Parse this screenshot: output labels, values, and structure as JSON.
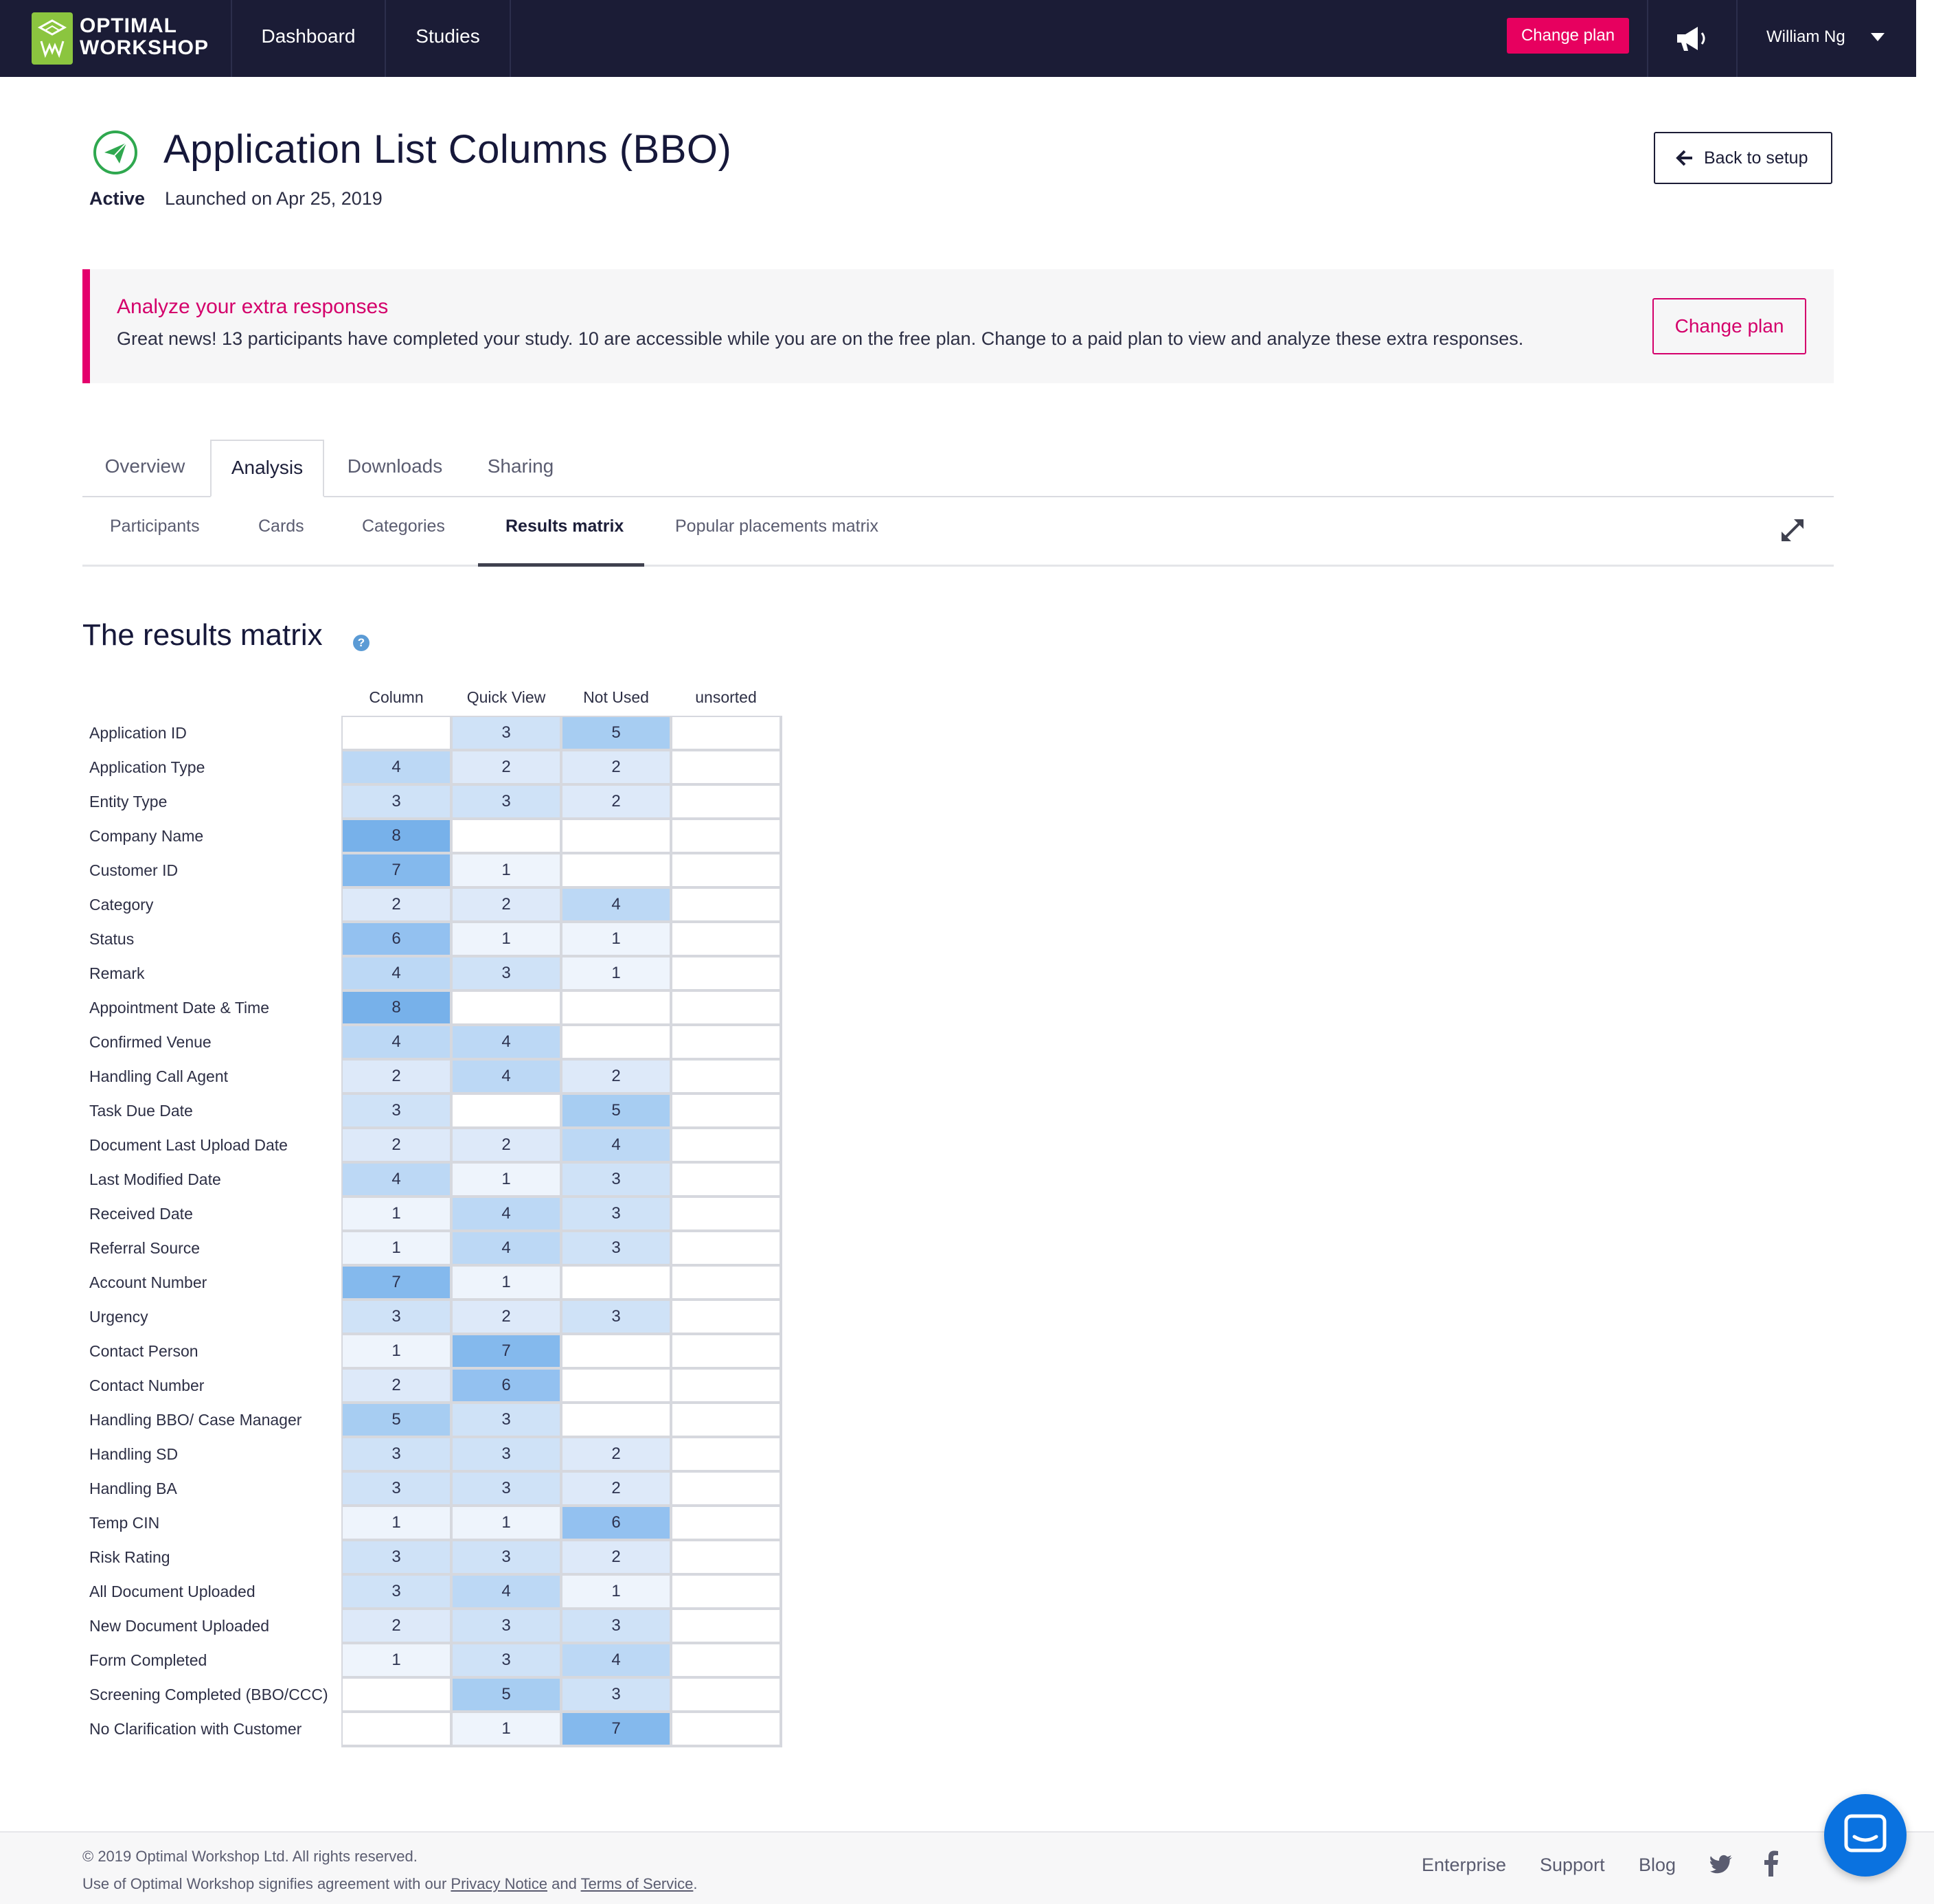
{
  "nav": {
    "logo_text": "OPTIMAL\nWORKSHOP",
    "links": [
      "Dashboard",
      "Studies"
    ],
    "change_plan": "Change plan",
    "user_name": "William Ng"
  },
  "study": {
    "title": "Application List Columns (BBO)",
    "status": "Active",
    "launched": "Launched on Apr 25, 2019",
    "back_label": "Back to setup"
  },
  "banner": {
    "title": "Analyze your extra responses",
    "text": "Great news! 13 participants have completed your study. 10 are accessible while you are on the free plan. Change to a paid plan to view and analyze these extra responses.",
    "button": "Change plan"
  },
  "tabs": [
    "Overview",
    "Analysis",
    "Downloads",
    "Sharing"
  ],
  "active_tab": "Analysis",
  "subtabs": [
    "Participants",
    "Cards",
    "Categories",
    "Results matrix",
    "Popular placements matrix"
  ],
  "active_subtab": "Results matrix",
  "matrix": {
    "title": "The results matrix",
    "help": "?",
    "columns": [
      "Column",
      "Quick View",
      "Not Used",
      "unsorted"
    ],
    "rows": [
      {
        "card": "Application ID",
        "values": [
          null,
          3,
          5,
          null
        ]
      },
      {
        "card": "Application Type",
        "values": [
          4,
          2,
          2,
          null
        ]
      },
      {
        "card": "Entity Type",
        "values": [
          3,
          3,
          2,
          null
        ]
      },
      {
        "card": "Company Name",
        "values": [
          8,
          null,
          null,
          null
        ]
      },
      {
        "card": "Customer ID",
        "values": [
          7,
          1,
          null,
          null
        ]
      },
      {
        "card": "Category",
        "values": [
          2,
          2,
          4,
          null
        ]
      },
      {
        "card": "Status",
        "values": [
          6,
          1,
          1,
          null
        ]
      },
      {
        "card": "Remark",
        "values": [
          4,
          3,
          1,
          null
        ]
      },
      {
        "card": "Appointment Date & Time",
        "values": [
          8,
          null,
          null,
          null
        ]
      },
      {
        "card": "Confirmed Venue",
        "values": [
          4,
          4,
          null,
          null
        ]
      },
      {
        "card": "Handling Call Agent",
        "values": [
          2,
          4,
          2,
          null
        ]
      },
      {
        "card": "Task Due Date",
        "values": [
          3,
          null,
          5,
          null
        ]
      },
      {
        "card": "Document Last Upload Date",
        "values": [
          2,
          2,
          4,
          null
        ]
      },
      {
        "card": "Last Modified Date",
        "values": [
          4,
          1,
          3,
          null
        ]
      },
      {
        "card": "Received Date",
        "values": [
          1,
          4,
          3,
          null
        ]
      },
      {
        "card": "Referral Source",
        "values": [
          1,
          4,
          3,
          null
        ]
      },
      {
        "card": "Account Number",
        "values": [
          7,
          1,
          null,
          null
        ]
      },
      {
        "card": "Urgency",
        "values": [
          3,
          2,
          3,
          null
        ]
      },
      {
        "card": "Contact Person",
        "values": [
          1,
          7,
          null,
          null
        ]
      },
      {
        "card": "Contact Number",
        "values": [
          2,
          6,
          null,
          null
        ]
      },
      {
        "card": "Handling BBO/ Case Manager",
        "values": [
          5,
          3,
          null,
          null
        ]
      },
      {
        "card": "Handling SD",
        "values": [
          3,
          3,
          2,
          null
        ]
      },
      {
        "card": "Handling BA",
        "values": [
          3,
          3,
          2,
          null
        ]
      },
      {
        "card": "Temp CIN",
        "values": [
          1,
          1,
          6,
          null
        ]
      },
      {
        "card": "Risk Rating",
        "values": [
          3,
          3,
          2,
          null
        ]
      },
      {
        "card": "All Document Uploaded",
        "values": [
          3,
          4,
          1,
          null
        ]
      },
      {
        "card": "New Document Uploaded",
        "values": [
          2,
          3,
          3,
          null
        ]
      },
      {
        "card": "Form Completed",
        "values": [
          1,
          3,
          4,
          null
        ]
      },
      {
        "card": "Screening Completed (BBO/CCC)",
        "values": [
          null,
          5,
          3,
          null
        ]
      },
      {
        "card": "No Clarification with Customer",
        "values": [
          null,
          1,
          7,
          null
        ]
      }
    ]
  },
  "footer": {
    "copyright": "© 2019 Optimal Workshop Ltd. All rights reserved.",
    "legal_prefix": "Use of Optimal Workshop signifies agreement with our",
    "privacy": "Privacy Notice",
    "and": "and",
    "terms": "Terms of Service",
    "links": [
      "Enterprise",
      "Support",
      "Blog"
    ]
  },
  "colors": {
    "nav_bg": "#1b1c36",
    "accent": "#e7005f",
    "logo_green": "#8bc53f",
    "active_green": "#2fa84f",
    "matrix_levels": [
      "#ffffff",
      "#eef4fc",
      "#dde9f9",
      "#cfe2f7",
      "#bcd8f5",
      "#a7cdf2",
      "#93c1f0",
      "#84b9ed",
      "#77b1ea"
    ]
  }
}
